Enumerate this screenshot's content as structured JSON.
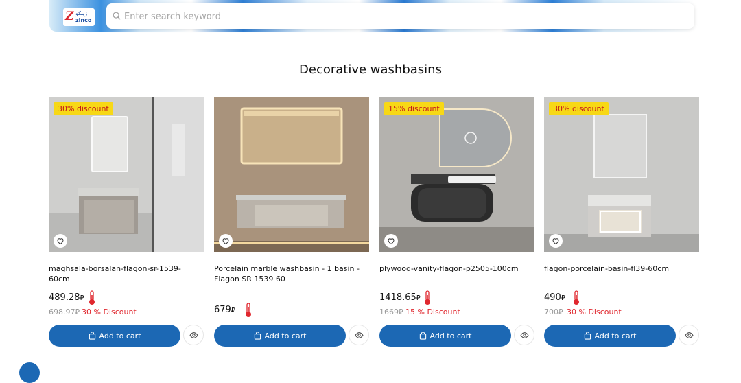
{
  "header": {
    "logo_text": "zinco",
    "logo_text_ar": "زينكو",
    "search_placeholder": "Enter search keyword"
  },
  "section": {
    "title": "Decorative washbasins"
  },
  "products": [
    {
      "badge": "30% discount",
      "name": "maghsala-borsalan-flagon-sr-1539-60cm",
      "price": "489.28",
      "old_price": "698.97",
      "discount": "30 % Discount",
      "cart_label": "Add to cart"
    },
    {
      "badge": "",
      "name": "Porcelain marble washbasin - 1 basin - Flagon SR 1539 60",
      "price": "679",
      "old_price": "",
      "discount": "",
      "cart_label": "Add to cart"
    },
    {
      "badge": "15% discount",
      "name": "plywood-vanity-flagon-p2505-100cm",
      "price": "1418.65",
      "old_price": "1669",
      "discount": "15 % Discount",
      "cart_label": "Add to cart"
    },
    {
      "badge": "30% discount",
      "name": "flagon-porcelain-basin-fl39-60cm",
      "price": "490",
      "old_price": "700",
      "discount": "30 % Discount",
      "cart_label": "Add to cart"
    }
  ],
  "colors": {
    "primary": "#1c68b4",
    "badge_bg": "#f7d816",
    "badge_text": "#c4161c",
    "discount_text": "#e0272e"
  }
}
